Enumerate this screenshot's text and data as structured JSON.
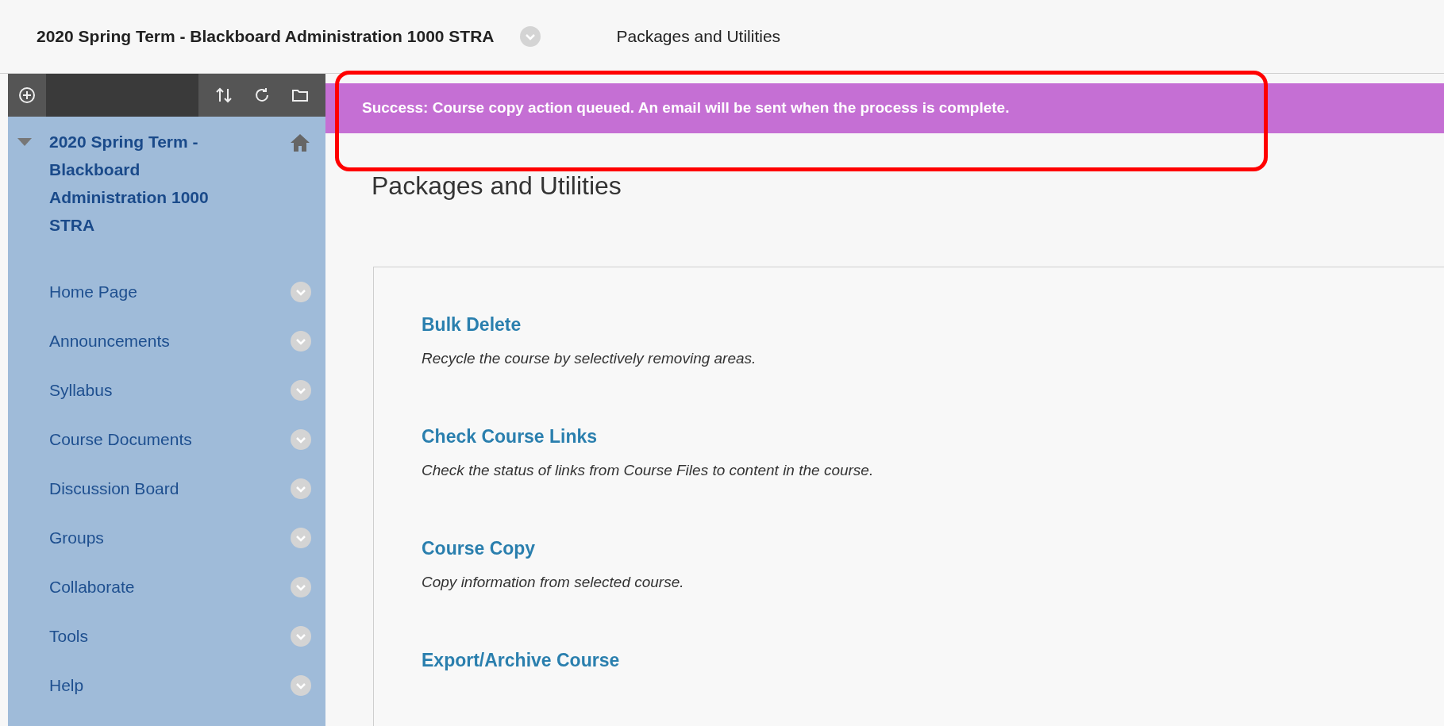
{
  "header": {
    "course_title": "2020 Spring Term - Blackboard Administration 1000 STRA",
    "page_title": "Packages and Utilities"
  },
  "sidebar": {
    "course_title": "2020 Spring Term - Blackboard Administration 1000 STRA",
    "expanded": true,
    "items": [
      {
        "label": "Home Page"
      },
      {
        "label": "Announcements"
      },
      {
        "label": "Syllabus"
      },
      {
        "label": "Course Documents"
      },
      {
        "label": "Discussion Board"
      },
      {
        "label": "Groups"
      },
      {
        "label": "Collaborate"
      },
      {
        "label": "Tools"
      },
      {
        "label": "Help"
      }
    ]
  },
  "banner": {
    "message": "Success: Course copy action queued. An email will be sent when the process is complete.",
    "highlighted": true
  },
  "heading": "Packages and Utilities",
  "tools": [
    {
      "title": "Bulk Delete",
      "description": "Recycle the course by selectively removing areas."
    },
    {
      "title": "Check Course Links",
      "description": "Check the status of links from Course Files to content in the course."
    },
    {
      "title": "Course Copy",
      "description": "Copy information from selected course."
    },
    {
      "title": "Export/Archive Course"
    }
  ]
}
